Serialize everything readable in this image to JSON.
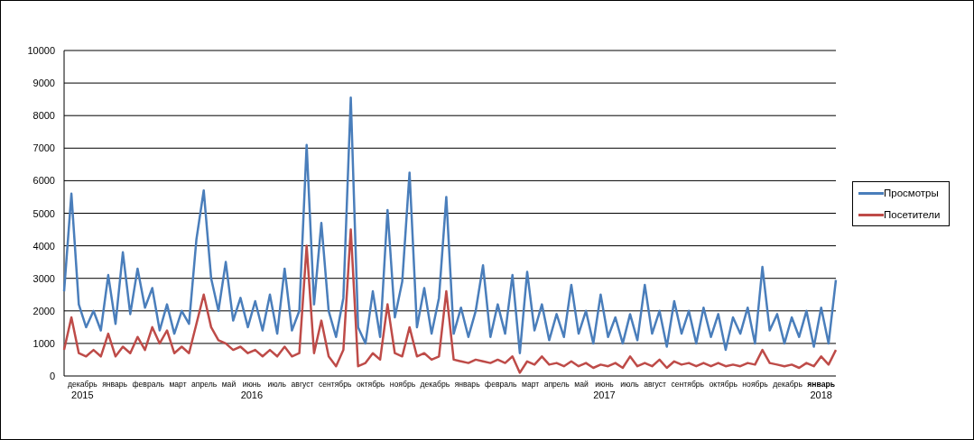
{
  "chart": {
    "chart_data": {
      "type": "line",
      "ylim": [
        0,
        10000
      ],
      "yticks": [
        0,
        1000,
        2000,
        3000,
        4000,
        5000,
        6000,
        7000,
        8000,
        9000,
        10000
      ],
      "grid": true,
      "series": [
        {
          "name": "Просмотры",
          "color": "#4a7ebb",
          "values": [
            2600,
            5600,
            2200,
            1500,
            2000,
            1400,
            3100,
            1600,
            3800,
            1900,
            3300,
            2100,
            2700,
            1400,
            2200,
            1300,
            2000,
            1600,
            4200,
            5700,
            3000,
            2000,
            3500,
            1700,
            2400,
            1500,
            2300,
            1400,
            2500,
            1300,
            3300,
            1400,
            2000,
            7100,
            2200,
            4700,
            2000,
            1200,
            2400,
            8550,
            1500,
            1000,
            2600,
            1200,
            5100,
            1800,
            2900,
            6250,
            1500,
            2700,
            1300,
            2400,
            5500,
            1300,
            2100,
            1200,
            2000,
            3400,
            1200,
            2200,
            1300,
            3100,
            700,
            3200,
            1400,
            2200,
            1100,
            1900,
            1200,
            2800,
            1300,
            2000,
            1000,
            2500,
            1200,
            1800,
            1000,
            1900,
            1100,
            2800,
            1300,
            2000,
            900,
            2300,
            1300,
            2000,
            1000,
            2100,
            1200,
            1900,
            800,
            1800,
            1300,
            2100,
            1000,
            3350,
            1400,
            1900,
            1000,
            1800,
            1200,
            2000,
            900,
            2100,
            1000,
            2950
          ]
        },
        {
          "name": "Посетители",
          "color": "#be4b48",
          "values": [
            800,
            1800,
            700,
            600,
            800,
            600,
            1300,
            600,
            900,
            700,
            1200,
            800,
            1500,
            1000,
            1400,
            700,
            900,
            700,
            1600,
            2500,
            1500,
            1100,
            1000,
            800,
            900,
            700,
            800,
            600,
            800,
            600,
            900,
            600,
            700,
            4000,
            700,
            1700,
            600,
            300,
            800,
            4500,
            300,
            400,
            700,
            500,
            2200,
            700,
            600,
            1500,
            600,
            700,
            500,
            600,
            2600,
            500,
            450,
            400,
            500,
            450,
            400,
            500,
            400,
            600,
            100,
            450,
            350,
            600,
            350,
            400,
            300,
            450,
            300,
            400,
            250,
            350,
            300,
            400,
            250,
            600,
            300,
            400,
            300,
            500,
            250,
            450,
            350,
            400,
            300,
            400,
            300,
            400,
            300,
            350,
            300,
            400,
            350,
            800,
            400,
            350,
            300,
            350,
            250,
            400,
            300,
            600,
            350,
            800
          ]
        }
      ]
    },
    "month_labels": [
      {
        "label": "декабрь",
        "bold": false,
        "year": "2015"
      },
      {
        "label": "январь",
        "bold": false
      },
      {
        "label": "февраль",
        "bold": false
      },
      {
        "label": "март",
        "bold": false
      },
      {
        "label": "апрель",
        "bold": false
      },
      {
        "label": "май",
        "bold": false
      },
      {
        "label": "июнь",
        "bold": false,
        "year": "2016"
      },
      {
        "label": "июль",
        "bold": false
      },
      {
        "label": "август",
        "bold": false
      },
      {
        "label": "сентябрь",
        "bold": false
      },
      {
        "label": "октябрь",
        "bold": false
      },
      {
        "label": "ноябрь",
        "bold": false
      },
      {
        "label": "декабрь",
        "bold": false
      },
      {
        "label": "январь",
        "bold": false
      },
      {
        "label": "февраль",
        "bold": false
      },
      {
        "label": "март",
        "bold": false
      },
      {
        "label": "апрель",
        "bold": false
      },
      {
        "label": "май",
        "bold": false
      },
      {
        "label": "июнь",
        "bold": false,
        "year": "2017"
      },
      {
        "label": "июль",
        "bold": false
      },
      {
        "label": "август",
        "bold": false
      },
      {
        "label": "сентябрь",
        "bold": false
      },
      {
        "label": "октябрь",
        "bold": false
      },
      {
        "label": "ноябрь",
        "bold": false
      },
      {
        "label": "декабрь",
        "bold": false
      },
      {
        "label": "январь",
        "bold": true,
        "year": "2018"
      }
    ]
  }
}
